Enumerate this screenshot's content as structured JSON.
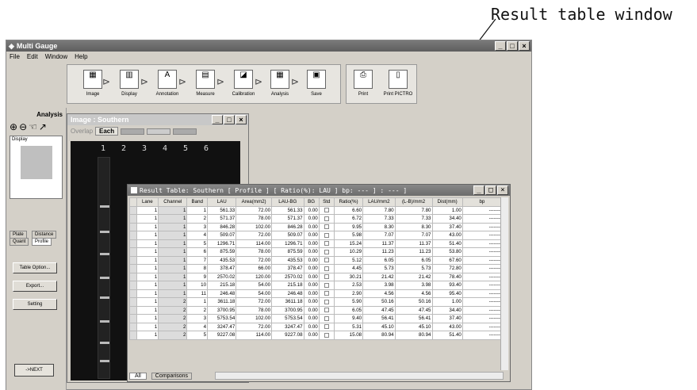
{
  "callout": "Result table window",
  "window": {
    "title": "Multi Gauge",
    "buttons": [
      "_",
      "□",
      "×"
    ]
  },
  "menu": [
    "File",
    "Edit",
    "Window",
    "Help"
  ],
  "toolbar": [
    {
      "label": "Image",
      "icon": "open-image-icon"
    },
    {
      "label": "Display",
      "icon": "display-icon"
    },
    {
      "label": "Annotation",
      "icon": "annotation-icon"
    },
    {
      "label": "Measure",
      "icon": "measure-icon"
    },
    {
      "label": "Calibration",
      "icon": "calibration-icon"
    },
    {
      "label": "Analysis",
      "icon": "analysis-icon"
    },
    {
      "label": "Save",
      "icon": "save-icon"
    }
  ],
  "print": {
    "print": "Print",
    "pictro": "Print PICTRO"
  },
  "analysis_panel": {
    "title": "Analysis",
    "display_label": "Display",
    "tabs": [
      "Plate",
      "Distance",
      "Quant",
      "Profile"
    ],
    "buttons": {
      "table_option": "Table Option...",
      "export": "Export...",
      "setting": "Setting"
    },
    "next": "->NEXT"
  },
  "image_window": {
    "title": "Image : Southern",
    "overlap": "Overlap",
    "each": "Each",
    "lanes": [
      "1",
      "2",
      "3",
      "4",
      "5",
      "6"
    ]
  },
  "result_window": {
    "title": "Result Table: Southern [ Profile ] [ Ratio(%): LAU ] bp: --- ] : --- ]",
    "columns": [
      "Lane",
      "Channel",
      "Band",
      "LAU",
      "Area(mm2)",
      "LAU-BG",
      "BG",
      "Std",
      "Ratio(%)",
      "LAU/mm2",
      "(L-B)/mm2",
      "Dist(mm)",
      "bp"
    ],
    "rows": [
      [
        "1",
        "1",
        "1",
        "561.33",
        "72.00",
        "561.33",
        "0.00",
        "",
        "6.60",
        "7.80",
        "7.80",
        "1.00",
        "-------"
      ],
      [
        "1",
        "1",
        "2",
        "571.37",
        "78.00",
        "571.37",
        "0.00",
        "",
        "6.72",
        "7.33",
        "7.33",
        "34.40",
        "-------"
      ],
      [
        "1",
        "1",
        "3",
        "846.28",
        "102.00",
        "846.28",
        "0.00",
        "",
        "9.95",
        "8.30",
        "8.30",
        "37.40",
        "-------"
      ],
      [
        "1",
        "1",
        "4",
        "509.07",
        "72.00",
        "509.07",
        "0.00",
        "",
        "5.98",
        "7.07",
        "7.07",
        "43.00",
        "-------"
      ],
      [
        "1",
        "1",
        "5",
        "1296.71",
        "114.00",
        "1296.71",
        "0.00",
        "",
        "15.24",
        "11.37",
        "11.37",
        "51.40",
        "-------"
      ],
      [
        "1",
        "1",
        "6",
        "875.59",
        "78.00",
        "875.59",
        "0.00",
        "",
        "10.29",
        "11.23",
        "11.23",
        "53.80",
        "-------"
      ],
      [
        "1",
        "1",
        "7",
        "435.53",
        "72.00",
        "435.53",
        "0.00",
        "",
        "5.12",
        "6.05",
        "6.05",
        "67.60",
        "-------"
      ],
      [
        "1",
        "1",
        "8",
        "378.47",
        "66.00",
        "378.47",
        "0.00",
        "",
        "4.45",
        "5.73",
        "5.73",
        "72.80",
        "-------"
      ],
      [
        "1",
        "1",
        "9",
        "2570.02",
        "120.00",
        "2570.02",
        "0.00",
        "",
        "30.21",
        "21.42",
        "21.42",
        "78.40",
        "-------"
      ],
      [
        "1",
        "1",
        "10",
        "215.18",
        "54.00",
        "215.18",
        "0.00",
        "",
        "2.53",
        "3.98",
        "3.98",
        "93.40",
        "-------"
      ],
      [
        "1",
        "1",
        "11",
        "246.48",
        "54.00",
        "246.48",
        "0.00",
        "",
        "2.90",
        "4.56",
        "4.56",
        "95.40",
        "-------"
      ],
      [
        "1",
        "2",
        "1",
        "3611.18",
        "72.00",
        "3611.18",
        "0.00",
        "",
        "5.90",
        "50.16",
        "50.16",
        "1.00",
        "-------"
      ],
      [
        "1",
        "2",
        "2",
        "3700.95",
        "78.00",
        "3700.95",
        "0.00",
        "",
        "6.05",
        "47.45",
        "47.45",
        "34.40",
        "-------"
      ],
      [
        "1",
        "2",
        "3",
        "5753.54",
        "102.00",
        "5753.54",
        "0.00",
        "",
        "9.40",
        "56.41",
        "56.41",
        "37.40",
        "-------"
      ],
      [
        "1",
        "2",
        "4",
        "3247.47",
        "72.00",
        "3247.47",
        "0.00",
        "",
        "5.31",
        "45.10",
        "45.10",
        "43.00",
        "-------"
      ],
      [
        "1",
        "2",
        "5",
        "9227.08",
        "114.00",
        "9227.08",
        "0.00",
        "",
        "15.08",
        "80.94",
        "80.94",
        "51.40",
        "-------"
      ]
    ],
    "sheets": [
      "All",
      "Comparisons"
    ]
  }
}
